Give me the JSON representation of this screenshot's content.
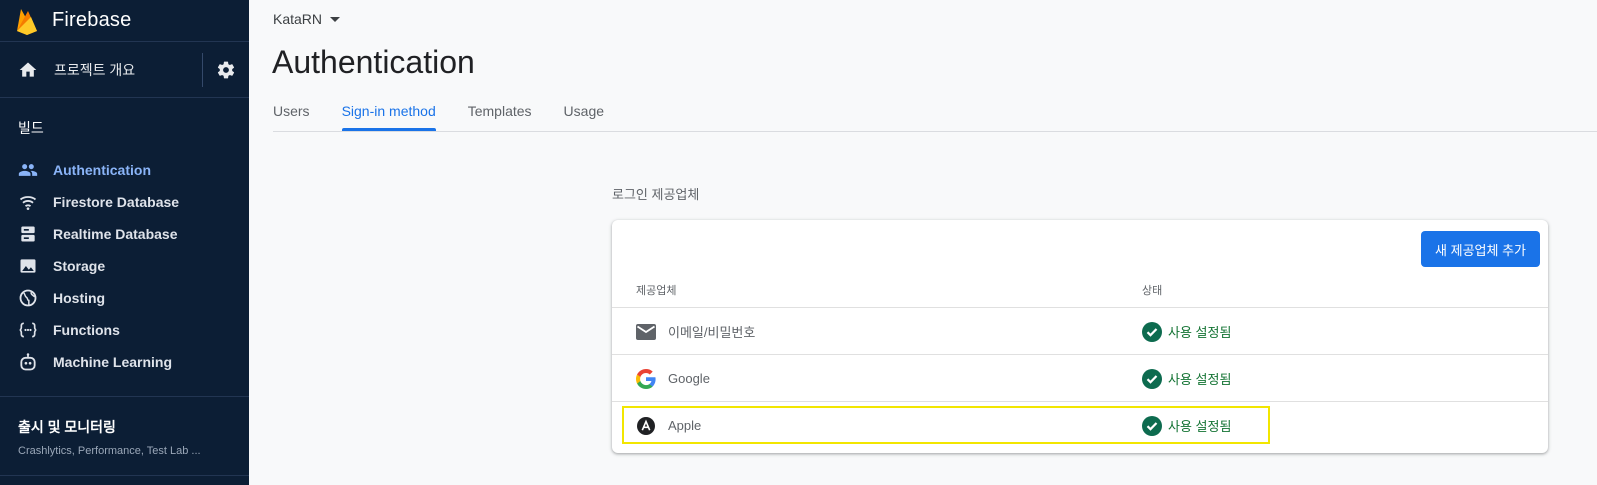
{
  "sidebar": {
    "brand": "Firebase",
    "overview_label": "프로젝트 개요",
    "build_section": "빌드",
    "items": [
      {
        "label": "Authentication",
        "icon": "people-icon",
        "active": true
      },
      {
        "label": "Firestore Database",
        "icon": "firestore-icon"
      },
      {
        "label": "Realtime Database",
        "icon": "database-icon"
      },
      {
        "label": "Storage",
        "icon": "image-icon"
      },
      {
        "label": "Hosting",
        "icon": "globe-icon"
      },
      {
        "label": "Functions",
        "icon": "functions-icon"
      },
      {
        "label": "Machine Learning",
        "icon": "robot-icon"
      }
    ],
    "release": {
      "title": "출시 및 모니터링",
      "subtitle": "Crashlytics, Performance, Test Lab ..."
    }
  },
  "header": {
    "project": "KataRN",
    "title": "Authentication"
  },
  "tabs": [
    {
      "label": "Users"
    },
    {
      "label": "Sign-in method",
      "active": true
    },
    {
      "label": "Templates"
    },
    {
      "label": "Usage"
    }
  ],
  "providers": {
    "heading": "로그인 제공업체",
    "add_button": "새 제공업체 추가",
    "col_provider": "제공업체",
    "col_status": "상태",
    "rows": [
      {
        "name": "이메일/비밀번호",
        "icon": "email-icon",
        "status": "사용 설정됨"
      },
      {
        "name": "Google",
        "icon": "google-icon",
        "status": "사용 설정됨"
      },
      {
        "name": "Apple",
        "icon": "apple-icon",
        "status": "사용 설정됨"
      }
    ]
  },
  "colors": {
    "sidebar_bg": "#0c1e35",
    "accent": "#1a73e8",
    "enabled": "#137333",
    "highlight": "#f2e600"
  }
}
